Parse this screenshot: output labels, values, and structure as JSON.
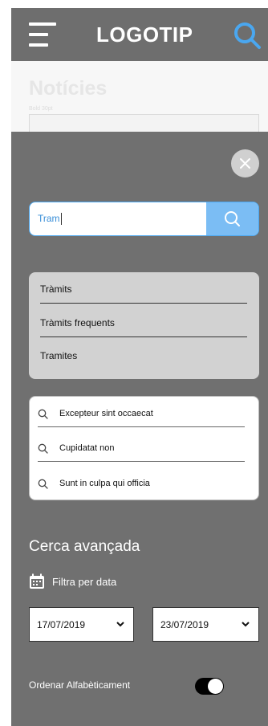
{
  "header": {
    "logo": "LOGOTIP",
    "menu_icon": "hamburger-menu-icon",
    "search_icon": "search-icon",
    "accent_color": "#4aa7f0"
  },
  "background_page": {
    "title": "Notícies",
    "subtitle": "Bold 30pt"
  },
  "search_panel": {
    "close_icon": "close-icon",
    "search": {
      "value": "Tram",
      "button_icon": "search-icon"
    },
    "suggestions": [
      "Tràmits",
      "Tràmits frequents",
      "Tramites"
    ],
    "recent_searches": [
      {
        "icon": "search-icon",
        "text": "Excepteur sint occaecat"
      },
      {
        "icon": "search-icon",
        "text": "Cupidatat non"
      },
      {
        "icon": "search-icon",
        "text": "Sunt in culpa qui officia"
      }
    ],
    "advanced": {
      "title": "Cerca avançada",
      "date_filter_label": "Filtra per data",
      "date_filter_icon": "calendar-icon",
      "date_from": "17/07/2019",
      "date_to": "23/07/2019",
      "sort_label": "Ordenar Alfabèticament",
      "sort_enabled": true
    }
  }
}
